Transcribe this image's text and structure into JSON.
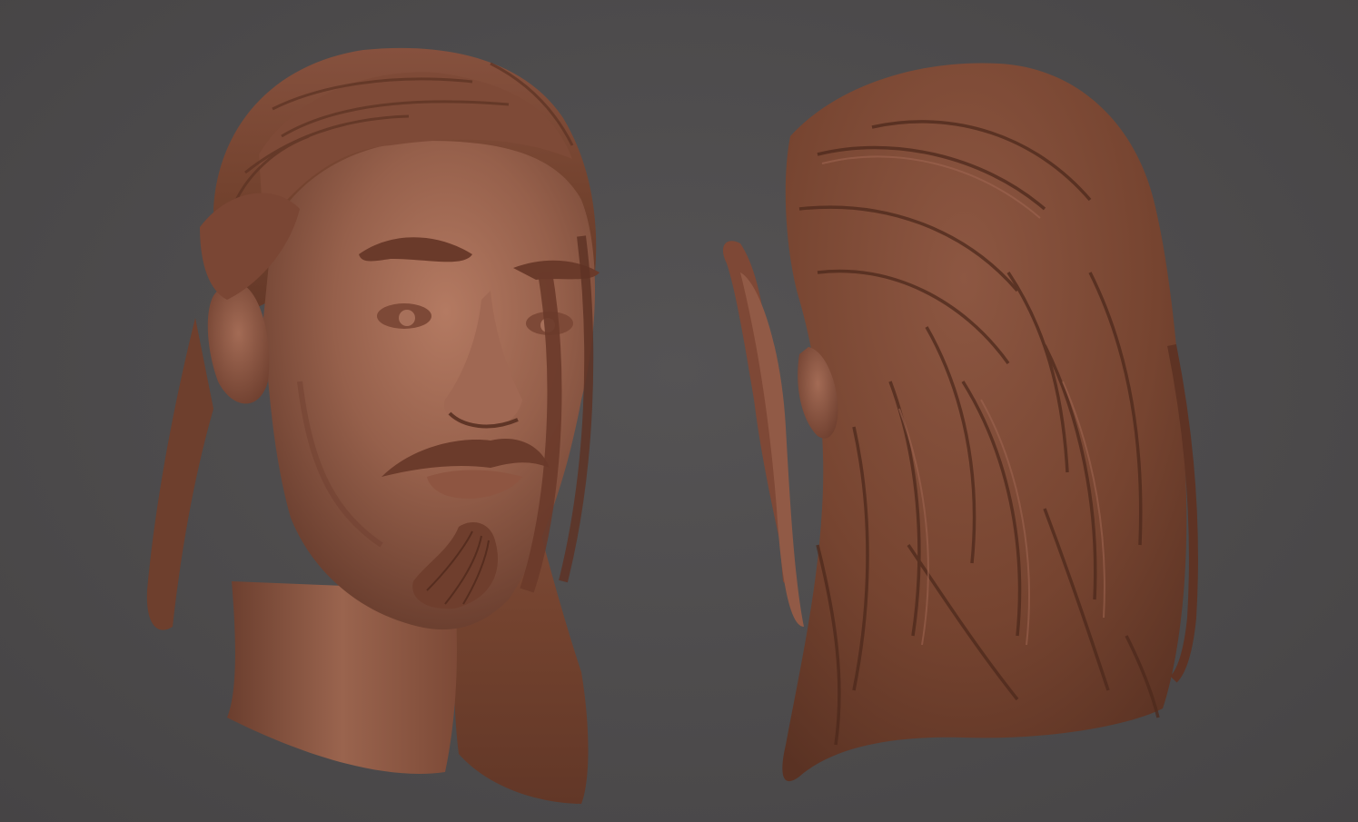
{
  "scene": {
    "background_color": "#4d4b4c",
    "material_color": "#8a5240",
    "views": [
      {
        "name": "front-three-quarter-view"
      },
      {
        "name": "back-three-quarter-view"
      }
    ]
  }
}
